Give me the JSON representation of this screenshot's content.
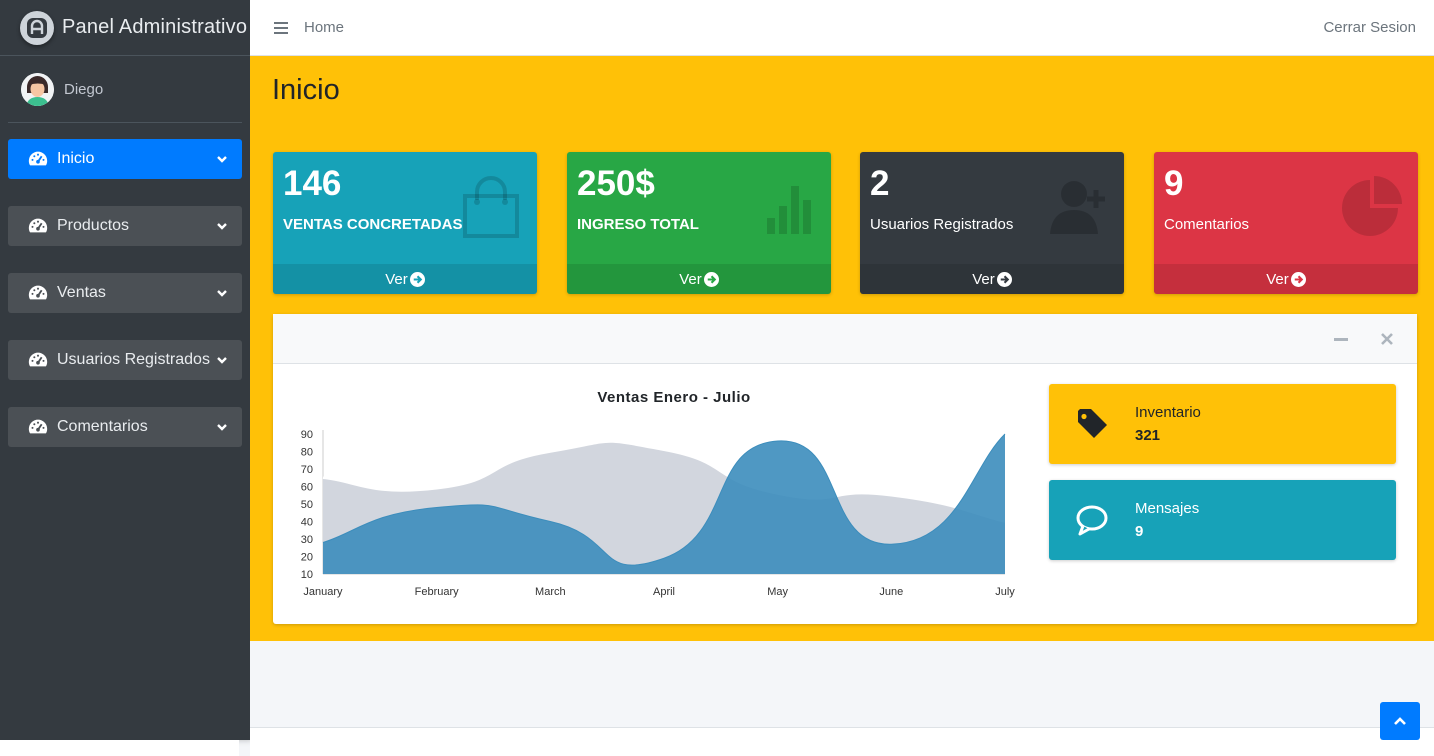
{
  "brand": {
    "name": "Panel Administrativo"
  },
  "user": {
    "name": "Diego"
  },
  "sidebar": {
    "items": [
      {
        "label": "Inicio",
        "active": true
      },
      {
        "label": "Productos"
      },
      {
        "label": "Ventas"
      },
      {
        "label": "Usuarios Registrados"
      },
      {
        "label": "Comentarios"
      }
    ]
  },
  "topbar": {
    "home_label": "Home",
    "logout_label": "Cerrar Sesion"
  },
  "page": {
    "title": "Inicio"
  },
  "boxes": [
    {
      "value": "146",
      "label": "VENTAS CONCRETADAS",
      "footer": "Ver",
      "color": "#17a2b8",
      "icon": "shopping-bag-icon"
    },
    {
      "value": "250$",
      "label": "INGRESO TOTAL",
      "footer": "Ver",
      "color": "#28a745",
      "icon": "bar-chart-icon"
    },
    {
      "value": "2",
      "label": "Usuarios Registrados",
      "footer": "Ver",
      "color": "#343a40",
      "icon": "user-plus-icon"
    },
    {
      "value": "9",
      "label": "Comentarios",
      "footer": "Ver",
      "color": "#dc3545",
      "icon": "pie-chart-icon"
    }
  ],
  "info": [
    {
      "label": "Inventario",
      "value": "321",
      "color": "#ffc107",
      "icon": "tag-icon"
    },
    {
      "label": "Mensajes",
      "value": "9",
      "color": "#17a2b8",
      "icon": "comment-icon"
    }
  ],
  "colors": {
    "content_bg": "#ffc107",
    "sidebar_bg": "#343a40",
    "accent": "#007bff"
  },
  "chart_data": {
    "type": "area",
    "title": "Ventas Enero - Julio",
    "categories": [
      "January",
      "February",
      "March",
      "April",
      "May",
      "June",
      "July"
    ],
    "yticks": [
      10,
      20,
      30,
      40,
      50,
      60,
      70,
      80,
      90
    ],
    "ylim": [
      10,
      90
    ],
    "series": [
      {
        "values": [
          65,
          59,
          80,
          81,
          56,
          55,
          40
        ],
        "color": "#d2d6de"
      },
      {
        "values": [
          28,
          48,
          40,
          19,
          86,
          27,
          90
        ],
        "color": "#3c8dbc"
      }
    ],
    "grid": false,
    "legend": "none"
  }
}
